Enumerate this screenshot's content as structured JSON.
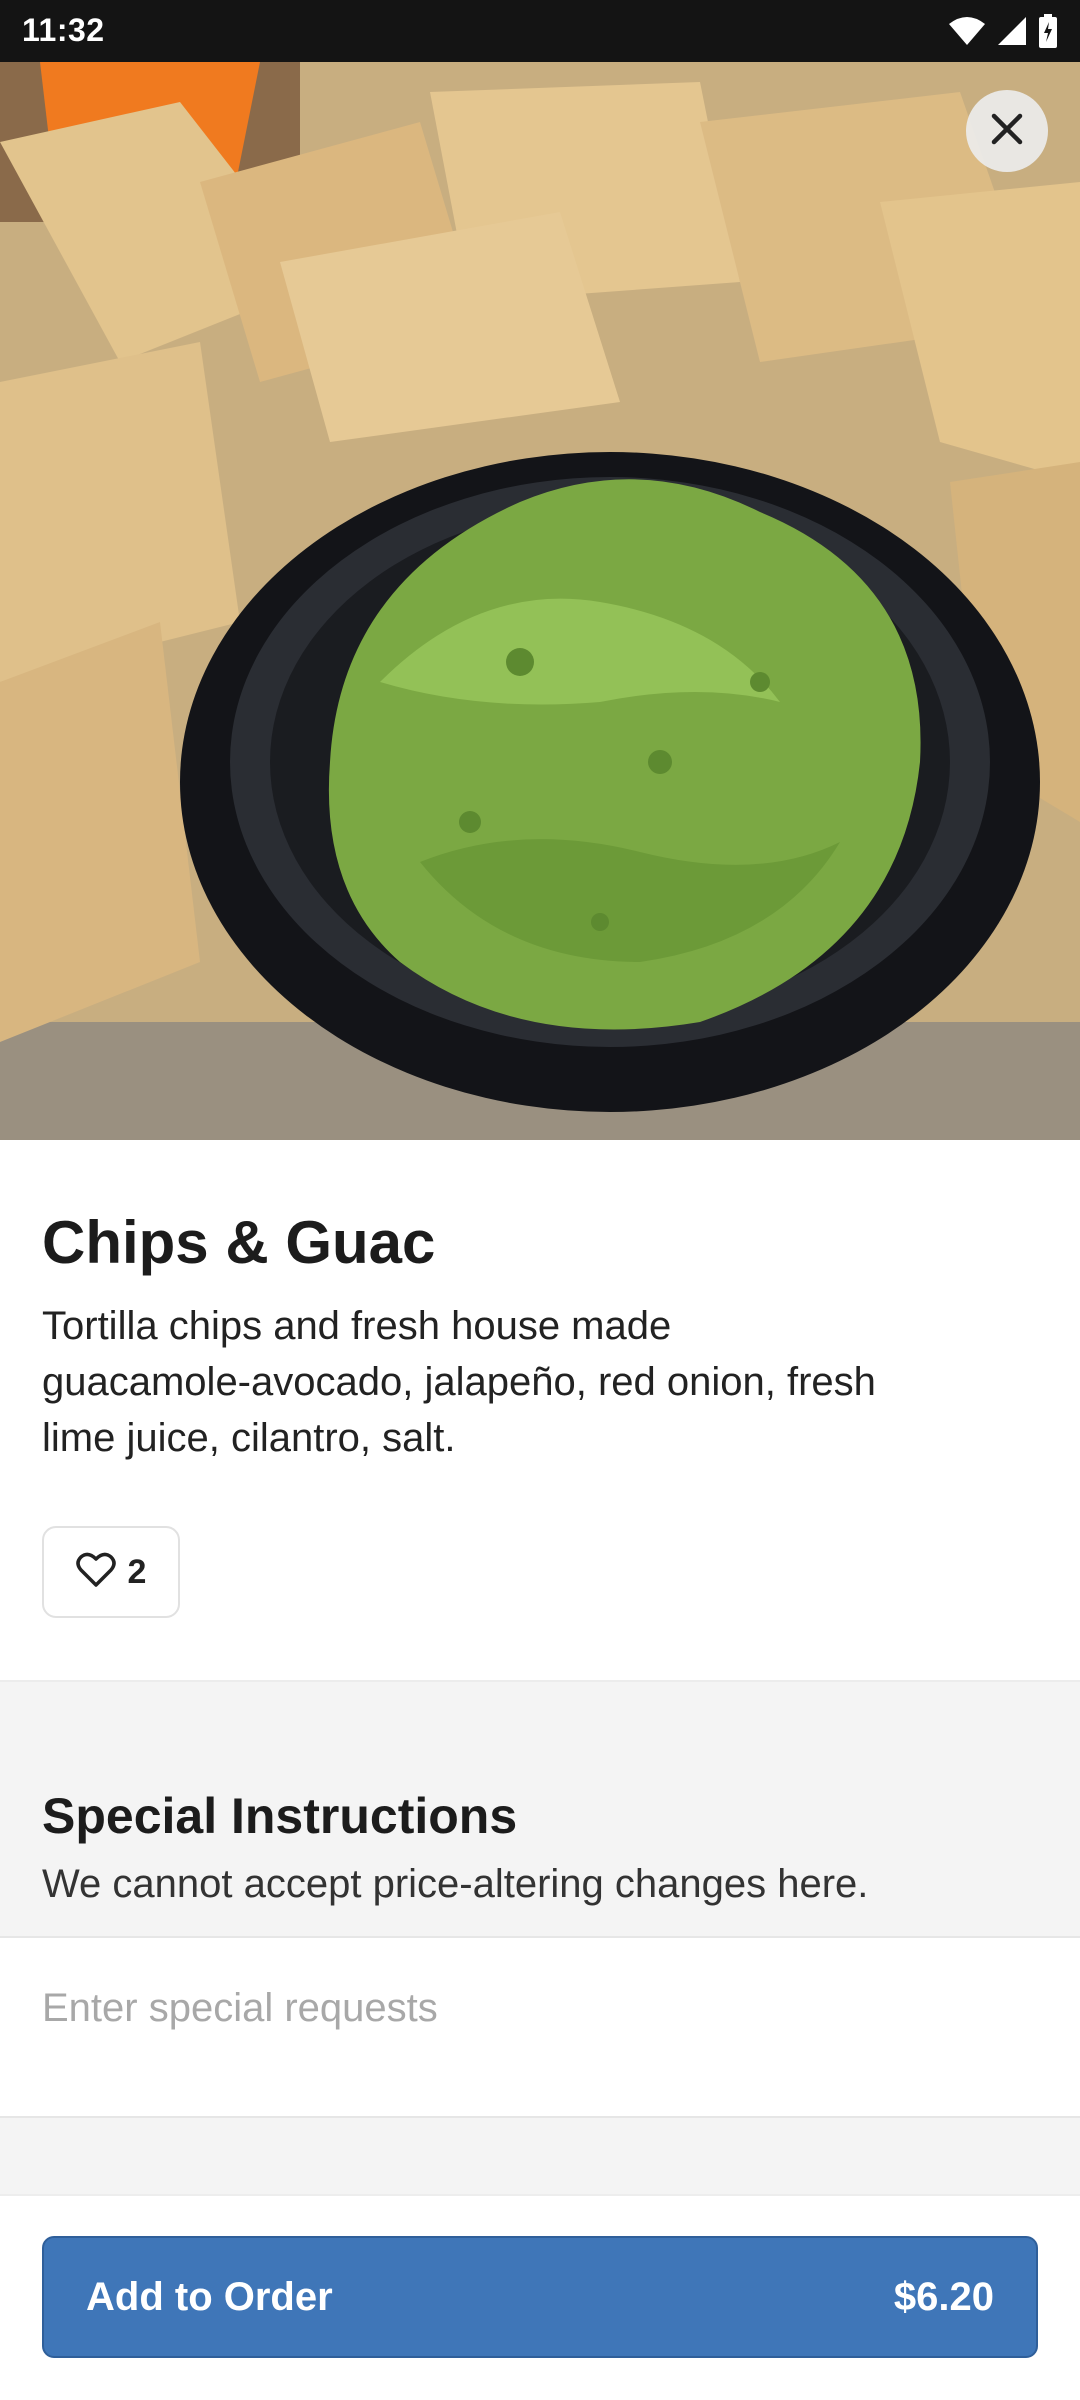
{
  "status_bar": {
    "time": "11:32",
    "icons": [
      "wifi-icon",
      "signal-icon",
      "battery-icon"
    ]
  },
  "item": {
    "title": "Chips & Guac",
    "description": "Tortilla chips and fresh house made\nguacamole-avocado, jalapeño, red onion, fresh\nlime juice,  cilantro, salt.",
    "likes": "2"
  },
  "special_instructions": {
    "title": "Special Instructions",
    "subtitle": "We cannot accept price-altering changes here.",
    "placeholder": "Enter special requests"
  },
  "footer": {
    "add_label": "Add to Order",
    "price": "$6.20"
  },
  "colors": {
    "primary": "#3f76b8",
    "guacamole": "#7fae45",
    "chips": "#d9b27a"
  }
}
